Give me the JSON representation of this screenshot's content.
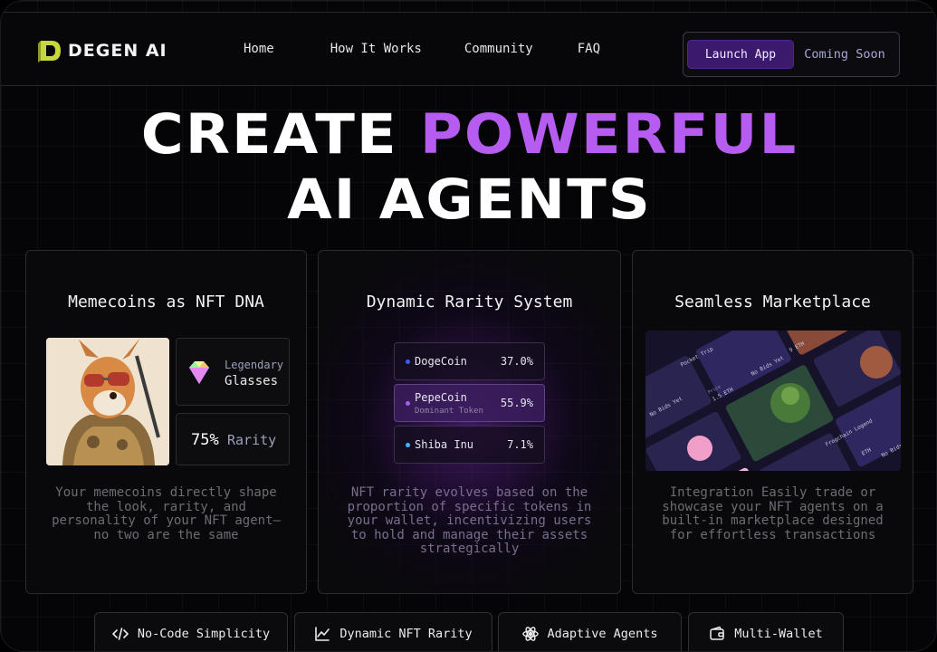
{
  "brand": {
    "name": "DEGEN AI",
    "logo_icon": "degen-logo-icon",
    "accent": "#c7d93a"
  },
  "nav": {
    "links": [
      "Home",
      "How It Works",
      "Community",
      "FAQ"
    ],
    "launch_label": "Launch App",
    "soon_label": "Coming Soon"
  },
  "hero": {
    "line1_a": "CREATE",
    "line1_b": "POWERFUL",
    "line2": "AI AGENTS",
    "accent_color": "#b65cf0"
  },
  "cards": [
    {
      "title": "Memecoins as NFT DNA",
      "trait_label": "Legendary",
      "trait_value": "Glasses",
      "rarity_pct": "75%",
      "rarity_word": "Rarity",
      "description": "Your memecoins directly shape the look, rarity, and personality of your NFT agent—no two are the same"
    },
    {
      "title": "Dynamic Rarity System",
      "tokens": [
        {
          "name": "DogeCoin",
          "pct": "37.0%",
          "sub": "",
          "dot": "#3b5bff"
        },
        {
          "name": "PepeCoin",
          "pct": "55.9%",
          "sub": "Dominant Token",
          "dot": "#a75bf0"
        },
        {
          "name": "Shiba Inu",
          "pct": "7.1%",
          "sub": "",
          "dot": "#3fb5ff"
        }
      ],
      "description": "NFT rarity evolves based on the proportion of specific tokens in your wallet, incentivizing users to hold and manage their assets strategically"
    },
    {
      "title": "Seamless Marketplace",
      "description": "Integration Easily trade or showcase your NFT agents on a built-in marketplace designed for effortless transactions",
      "market_labels": [
        "Pocket Trip",
        "No Bids Yet",
        "Price",
        "1.5 ETH",
        "No Bids Yet",
        "Frogchain Legend",
        "ETH",
        "No Bids",
        "9 ETH"
      ]
    }
  ],
  "features": [
    {
      "label": "No-Code Simplicity",
      "icon": "code-icon"
    },
    {
      "label": "Dynamic NFT Rarity",
      "icon": "chart-line-icon"
    },
    {
      "label": "Adaptive Agents",
      "icon": "atom-icon"
    },
    {
      "label": "Multi-Wallet",
      "icon": "wallet-icon"
    }
  ]
}
